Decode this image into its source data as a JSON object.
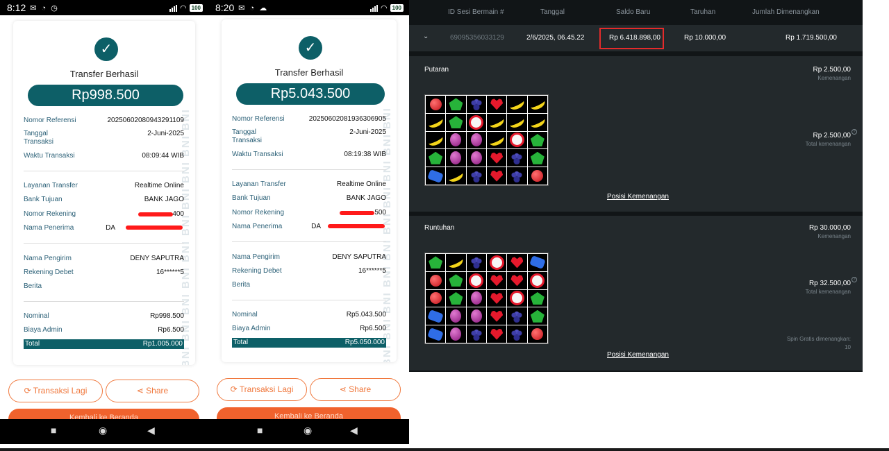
{
  "phones": [
    {
      "status": {
        "time": "8:12",
        "battery": "100"
      },
      "receipt": {
        "watermark": "BNI BNI BNI BNI BNI BNI BNI BNI BNI BNI",
        "title": "Transfer Berhasil",
        "amount": "Rp998.500",
        "no_ref_label": "Nomor Referensi",
        "no_ref": "20250602080943291109",
        "tanggal_label": "Tanggal",
        "transaksi_label": "Transaksi",
        "tanggal": "2-Juni-2025",
        "waktu_label": "Waktu Transaksi",
        "waktu": "08:09:44 WIB",
        "layanan_label": "Layanan Transfer",
        "layanan": "Realtime Online",
        "bank_label": "Bank Tujuan",
        "bank": "BANK JAGO",
        "rekening_label": "Nomor Rekening",
        "rekening": "400",
        "penerima_label": "Nama Penerima",
        "penerima": "DA",
        "pengirim_label": "Nama Pengirim",
        "pengirim": "DENY SAPUTRA",
        "debet_label": "Rekening Debet",
        "debet": "16******5",
        "berita_label": "Berita",
        "nominal_label": "Nominal",
        "nominal": "Rp998.500",
        "admin_label": "Biaya Admin",
        "admin": "Rp6.500",
        "total_label": "Total",
        "total": "Rp1.005.000"
      },
      "buttons": {
        "again": "Transaksi Lagi",
        "share": "Share",
        "home": "Kembali ke Beranda"
      }
    },
    {
      "status": {
        "time": "8:20",
        "battery": "100"
      },
      "receipt": {
        "watermark": "BNI BNI BNI BNI BNI BNI BNI BNI BNI BNI",
        "title": "Transfer Berhasil",
        "amount": "Rp5.043.500",
        "no_ref_label": "Nomor Referensi",
        "no_ref": "20250602081936306905",
        "tanggal_label": "Tanggal",
        "transaksi_label": "Transaksi",
        "tanggal": "2-Juni-2025",
        "waktu_label": "Waktu Transaksi",
        "waktu": "08:19:38 WIB",
        "layanan_label": "Layanan Transfer",
        "layanan": "Realtime Online",
        "bank_label": "Bank Tujuan",
        "bank": "BANK JAGO",
        "rekening_label": "Nomor Rekening",
        "rekening": "500",
        "penerima_label": "Nama Penerima",
        "penerima": "DA",
        "pengirim_label": "Nama Pengirim",
        "pengirim": "DENY SAPUTRA",
        "debet_label": "Rekening Debet",
        "debet": "16******5",
        "berita_label": "Berita",
        "nominal_label": "Nominal",
        "nominal": "Rp5.043.500",
        "admin_label": "Biaya Admin",
        "admin": "Rp6.500",
        "total_label": "Total",
        "total": "Rp5.050.000"
      },
      "buttons": {
        "again": "Transaksi Lagi",
        "share": "Share",
        "home": "Kembali ke Beranda"
      }
    }
  ],
  "history": {
    "headers": {
      "session_id": "ID Sesi Bermain #",
      "date": "Tanggal",
      "balance": "Saldo Baru",
      "bet": "Taruhan",
      "won": "Jumlah Dimenangkan"
    },
    "row": {
      "session_id": "69095356033129",
      "date": "2/6/2025, 06.45.22",
      "balance": "Rp 6.418.898,00",
      "bet": "Rp 10.000,00",
      "won": "Rp 1.719.500,00"
    },
    "putaran": {
      "name": "Putaran",
      "win": "Rp 2.500,00",
      "win_label": "Kemenangan",
      "total": "Rp 2.500,00",
      "total_label": "Total kemenangan",
      "link": "Posisi Kemenangan",
      "grid": [
        "apple",
        "pent",
        "grape",
        "heart",
        "banana",
        "banana",
        "banana",
        "pent",
        "candy",
        "banana",
        "banana",
        "banana",
        "banana",
        "plum",
        "plum",
        "banana",
        "candy",
        "pent",
        "pent",
        "plum",
        "plum",
        "heart",
        "grape",
        "pent",
        "blue",
        "banana",
        "grape",
        "heart",
        "grape",
        "apple"
      ]
    },
    "runtuhan": {
      "name": "Runtuhan",
      "win": "Rp 30.000,00",
      "win_label": "Kemenangan",
      "total": "Rp 32.500,00",
      "total_label": "Total kemenangan",
      "spin_label": "Spin Gratis dimenangkan:",
      "spin_value": "10",
      "link": "Posisi Kemenangan",
      "grid": [
        "pent",
        "banana",
        "grape",
        "candy",
        "heart",
        "blue",
        "apple",
        "pent",
        "candy",
        "heart",
        "heart",
        "candy",
        "apple",
        "pent",
        "plum",
        "heart",
        "candy",
        "pent",
        "blue",
        "plum",
        "plum",
        "heart",
        "grape",
        "pent",
        "blue",
        "plum",
        "grape",
        "heart",
        "grape",
        "apple"
      ]
    }
  },
  "colors": {
    "teal": "#0d5f67",
    "orange": "#f0622d",
    "highlight": "#e52b2b",
    "panel": "#23292c"
  }
}
